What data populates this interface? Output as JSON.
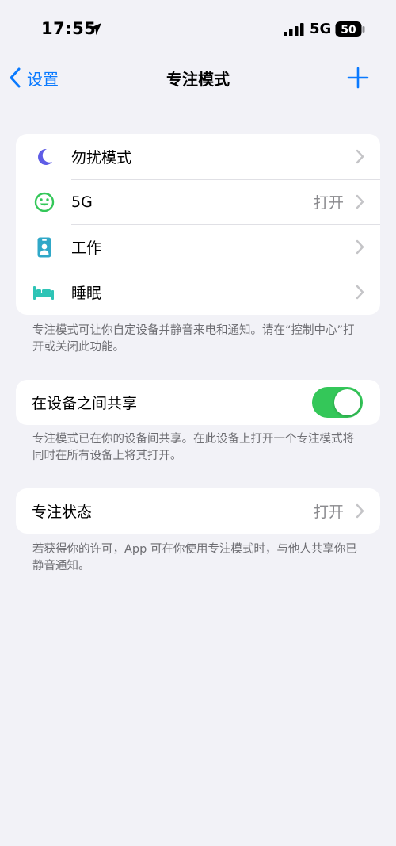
{
  "status_bar": {
    "time": "17:55",
    "network": "5G",
    "battery": "50"
  },
  "nav": {
    "back_label": "设置",
    "title": "专注模式"
  },
  "focus_modes": {
    "items": [
      {
        "label": "勿扰模式",
        "value": "",
        "icon": "moon-icon"
      },
      {
        "label": "5G",
        "value": "打开",
        "icon": "smiley-icon"
      },
      {
        "label": "工作",
        "value": "",
        "icon": "badge-person-icon"
      },
      {
        "label": "睡眠",
        "value": "",
        "icon": "bed-icon"
      }
    ],
    "footnote": "专注模式可让你自定设备并静音来电和通知。请在“控制中心”打开或关闭此功能。"
  },
  "share": {
    "label": "在设备之间共享",
    "toggle_on": true,
    "footnote": "专注模式已在你的设备间共享。在此设备上打开一个专注模式将同时在所有设备上将其打开。"
  },
  "focus_status": {
    "label": "专注状态",
    "value": "打开",
    "footnote": "若获得你的许可，App 可在你使用专注模式时，与他人共享你已静音通知。"
  },
  "colors": {
    "accent": "#0a7aff",
    "moon": "#5e5ce6",
    "smiley": "#34c759",
    "work": "#30a8c8",
    "sleep": "#2ec4b6",
    "toggle_on": "#34c759"
  }
}
